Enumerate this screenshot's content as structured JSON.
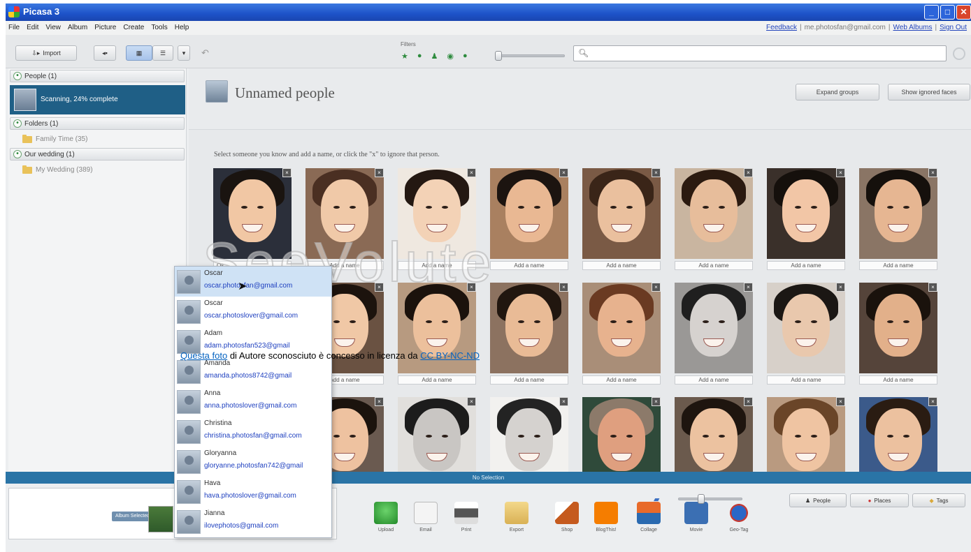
{
  "window": {
    "title": "Picasa 3"
  },
  "menu": [
    "File",
    "Edit",
    "View",
    "Album",
    "Picture",
    "Create",
    "Tools",
    "Help"
  ],
  "account": {
    "feedback": "Feedback",
    "email": "me.photosfan@gmail.com",
    "web_albums": "Web Albums",
    "sign_out": "Sign Out"
  },
  "toolbar": {
    "import_label": "Import",
    "filters_label": "Filters",
    "search_value": ""
  },
  "sidebar": {
    "people_header": "People (1)",
    "scanning_label": "Scanning, 24% complete",
    "folders_header": "Folders (1)",
    "folder_item": "Family Time (35)",
    "wedding_header": "Our wedding (1)",
    "wedding_item": "My Wedding (389)"
  },
  "main": {
    "title": "Unnamed people",
    "expand_groups": "Expand groups",
    "show_ignored": "Show ignored faces",
    "instructions": "Select someone you know and add a name, or click the \"x\" to ignore that person.",
    "add_name_label": "Add a name",
    "first_card_input": "Os"
  },
  "dropdown": [
    {
      "name": "Oscar",
      "email": "oscar.photosfan@gmail.com"
    },
    {
      "name": "Oscar",
      "email": "oscar.photoslover@gmail.com"
    },
    {
      "name": "Adam",
      "email": "adam.photosfan523@gmail"
    },
    {
      "name": "Amanda",
      "email": "amanda.photos8742@gmail"
    },
    {
      "name": "Anna",
      "email": "anna.photoslover@gmail.com"
    },
    {
      "name": "Christina",
      "email": "christina.photosfan@gmail.com"
    },
    {
      "name": "Gloryanna",
      "email": "gloryanne.photosfan742@gmail"
    },
    {
      "name": "Hava",
      "email": "hava.photoslover@gmail.com"
    },
    {
      "name": "Jianna",
      "email": "ilovephotos@gmail.com"
    }
  ],
  "status": {
    "selection": "No Selection"
  },
  "bottom": {
    "album_selected": "Album Selected",
    "actions": [
      "Upload",
      "Email",
      "Print",
      "Export",
      "Shop",
      "BlogThis!",
      "Collage",
      "Movie",
      "Geo-Tag"
    ],
    "tabs": [
      "People",
      "Places",
      "Tags"
    ]
  },
  "overlay": {
    "watermark": "SeeVolute",
    "attribution_link": "Questa foto",
    "attribution_text": " di Autore sconosciuto è concesso in licenza da ",
    "license_link": "CC BY-NC-ND"
  },
  "colors": {
    "status_bar": "#2a74a6",
    "selected_sidebar": "#1f5f86",
    "link": "#1d3fbf"
  }
}
